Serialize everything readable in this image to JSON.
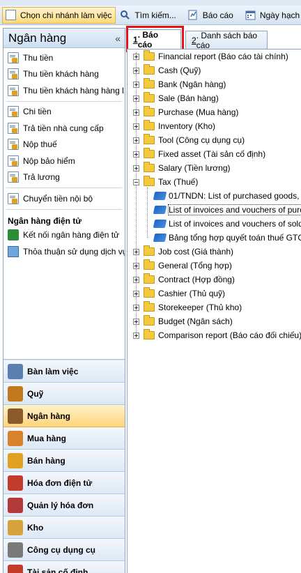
{
  "toolbar": {
    "branch_button": "Chọn chi nhánh làm việc",
    "search_button": "Tìm kiếm...",
    "report_button": "Báo cáo",
    "date_button": "Ngày hạch t"
  },
  "left_panel": {
    "title": "Ngân hàng",
    "collapse": "«",
    "group1": [
      "Thu tiền",
      "Thu tiền khách hàng",
      "Thu tiền khách hàng hàng l..."
    ],
    "group2": [
      "Chi tiền",
      "Trả tiền nhà cung cấp",
      "Nộp thuế",
      "Nộp bảo hiểm",
      "Trả lương"
    ],
    "group3": [
      "Chuyển tiền nội bộ"
    ],
    "ebank_title": "Ngân hàng điện tử",
    "ebank_items": [
      "Kết nối ngân hàng điện tử",
      "Thỏa thuận sử dụng dịch vụ"
    ]
  },
  "modules": [
    {
      "label": "Bàn làm việc",
      "color": "#5a7fb0"
    },
    {
      "label": "Quỹ",
      "color": "#c2791d"
    },
    {
      "label": "Ngân hàng",
      "color": "#8b5a2b",
      "active": true
    },
    {
      "label": "Mua hàng",
      "color": "#d9822b"
    },
    {
      "label": "Bán hàng",
      "color": "#e0a020"
    },
    {
      "label": "Hóa đơn điện tử",
      "color": "#c23b2b"
    },
    {
      "label": "Quản lý hóa đơn",
      "color": "#b33a3a"
    },
    {
      "label": "Kho",
      "color": "#d6a33a"
    },
    {
      "label": "Công cụ dụng cụ",
      "color": "#7a7a7a"
    },
    {
      "label": "Tài sản cố định",
      "color": "#c23b2b"
    }
  ],
  "tabs": [
    {
      "num": "1",
      "label": ". Báo cáo"
    },
    {
      "num": "2",
      "label": ". Danh sách báo cáo"
    }
  ],
  "tree": [
    {
      "label": "Financial report (Báo cáo tài chính)",
      "type": "folder"
    },
    {
      "label": "Cash (Quỹ)",
      "type": "folder"
    },
    {
      "label": "Bank (Ngân hàng)",
      "type": "folder"
    },
    {
      "label": "Sale (Bán hàng)",
      "type": "folder"
    },
    {
      "label": "Purchase (Mua hàng)",
      "type": "folder"
    },
    {
      "label": "Inventory (Kho)",
      "type": "folder"
    },
    {
      "label": "Tool (Công cụ dụng cụ)",
      "type": "folder"
    },
    {
      "label": "Fixed asset (Tài sản cố định)",
      "type": "folder"
    },
    {
      "label": "Salary (Tiền lương)",
      "type": "folder"
    },
    {
      "label": "Tax (Thuế)",
      "type": "folder",
      "expanded": true
    },
    {
      "label": "01/TNDN: List of purchased goods,",
      "type": "report"
    },
    {
      "label": "List of invoices and vouchers of purc",
      "type": "report",
      "selected": true
    },
    {
      "label": "List of invoices and vouchers of sold",
      "type": "report"
    },
    {
      "label": "Bảng tổng hợp quyết toán thuế GTG",
      "type": "report"
    },
    {
      "label": "Job cost (Giá thành)",
      "type": "folder"
    },
    {
      "label": "General (Tổng hợp)",
      "type": "folder"
    },
    {
      "label": "Contract (Hợp đồng)",
      "type": "folder"
    },
    {
      "label": "Cashier (Thủ quỹ)",
      "type": "folder"
    },
    {
      "label": "Storekeeper (Thủ kho)",
      "type": "folder"
    },
    {
      "label": "Budget (Ngân sách)",
      "type": "folder"
    },
    {
      "label": "Comparison report (Báo cáo đối chiếu)",
      "type": "folder"
    }
  ]
}
